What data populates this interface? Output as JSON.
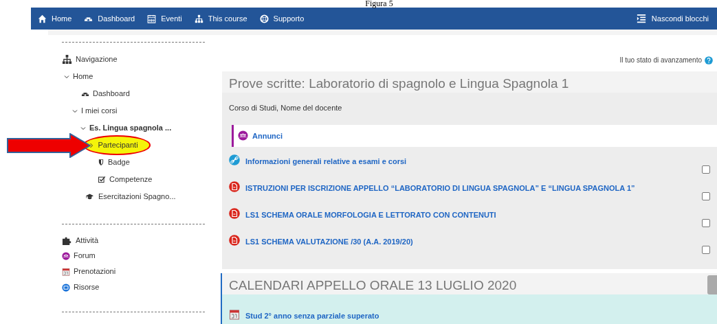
{
  "caption": "Figura 5",
  "navbar": {
    "items": [
      {
        "label": "Home",
        "kind": "home"
      },
      {
        "label": "Dashboard",
        "kind": "dashboard"
      },
      {
        "label": "Eventi",
        "kind": "calendar"
      },
      {
        "label": "This course",
        "kind": "sitemap"
      },
      {
        "label": "Supporto",
        "kind": "lifebuoy"
      }
    ],
    "right": {
      "label": "Nascondi blocchi"
    }
  },
  "sidebar": {
    "navigation": {
      "title": "Navigazione",
      "items": [
        {
          "label": "Home",
          "kind": "branch",
          "expanded": true,
          "children": [
            {
              "label": "Dashboard",
              "kind": "dashboard"
            },
            {
              "label": "I miei corsi",
              "kind": "branch",
              "expanded": true,
              "children": [
                {
                  "label": "Es. Lingua spagnola ...",
                  "kind": "branch",
                  "expanded": true,
                  "bold": true,
                  "children": [
                    {
                      "label": "Partecipanti",
                      "kind": "branch",
                      "expanded": false,
                      "highlighted": true
                    },
                    {
                      "label": "Badge",
                      "kind": "shield"
                    },
                    {
                      "label": "Competenze",
                      "kind": "checkbox"
                    }
                  ]
                },
                {
                  "label": "Esercitazioni Spagno...",
                  "kind": "course"
                }
              ]
            }
          ]
        }
      ]
    },
    "activities": {
      "title": "Attività",
      "items": [
        {
          "label": "Forum",
          "kind": "forum"
        },
        {
          "label": "Prenotazioni",
          "kind": "calendar"
        },
        {
          "label": "Risorse",
          "kind": "resource"
        }
      ]
    }
  },
  "content": {
    "progress_label": "Il tuo stato di avanzamento",
    "sections": [
      {
        "title": "Prove scritte: Laboratorio di spagnolo e Lingua Spagnola 1",
        "current": false,
        "summary": "Corso di Studi, Nome del docente",
        "activities": [
          {
            "label": "Annunci",
            "kind": "forum"
          },
          {
            "label": "Informazioni generali relative a esami e corsi",
            "kind": "url",
            "checked": false
          },
          {
            "label": "ISTRUZIONI PER ISCRIZIONE APPELLO “LABORATORIO DI LINGUA SPAGNOLA” E “LINGUA SPAGNOLA 1”",
            "kind": "pdf",
            "checked": false
          },
          {
            "label": "LS1 SCHEMA ORALE MORFOLOGIA E LETTORATO CON CONTENUTI",
            "kind": "pdf",
            "checked": false
          },
          {
            "label": "LS1 SCHEMA VALUTAZIONE /30 (A.A. 2019/20)",
            "kind": "pdf",
            "checked": false
          }
        ]
      },
      {
        "title": "CALENDARI APPELLO ORALE 13 LUGLIO 2020",
        "current": true,
        "activities": [
          {
            "label": "Stud 2° anno senza parziale superato",
            "kind": "calendar"
          }
        ]
      }
    ]
  }
}
